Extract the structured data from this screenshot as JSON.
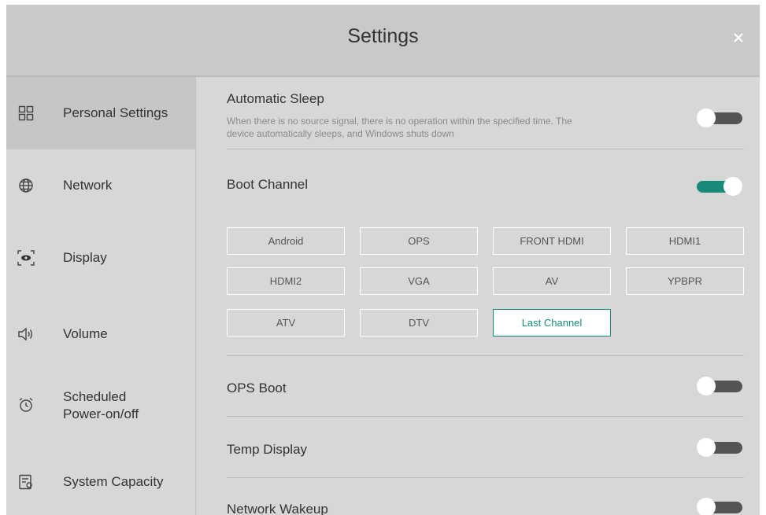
{
  "header": {
    "title": "Settings",
    "close_icon": "close-icon"
  },
  "sidebar": {
    "items": [
      {
        "label": "Personal Settings",
        "icon": "grid-icon",
        "active": true
      },
      {
        "label": "Network",
        "icon": "globe-icon",
        "active": false
      },
      {
        "label": "Display",
        "icon": "display-icon",
        "active": false
      },
      {
        "label": "Volume",
        "icon": "speaker-icon",
        "active": false
      },
      {
        "label": "Scheduled Power-on/off",
        "label_line1": "Scheduled",
        "label_line2": "Power-on/off",
        "icon": "alarm-clock-icon",
        "active": false
      },
      {
        "label": "System Capacity",
        "icon": "storage-icon",
        "active": false
      }
    ]
  },
  "settings": {
    "automatic_sleep": {
      "title": "Automatic Sleep",
      "desc_line1": "When there is no source signal, there is no operation within the specified time. The",
      "desc_line2": "device automatically sleeps, and Windows shuts down",
      "enabled": false
    },
    "boot_channel": {
      "title": "Boot Channel",
      "enabled": true,
      "channels": [
        "Android",
        "OPS",
        "FRONT HDMI",
        "HDMI1",
        "HDMI2",
        "VGA",
        "AV",
        "YPBPR",
        "ATV",
        "DTV",
        "Last Channel"
      ],
      "selected": "Last Channel"
    },
    "ops_boot": {
      "title": "OPS Boot",
      "enabled": false
    },
    "temp_display": {
      "title": "Temp Display",
      "enabled": false
    },
    "network_wakeup": {
      "title": "Network Wakeup",
      "enabled": false
    }
  },
  "colors": {
    "accent": "#178a79",
    "toggle_off_track": "#545454",
    "background": "#d7d7d7",
    "header_bg": "#c9c9c9",
    "sidebar_active": "#c6c6c6"
  }
}
